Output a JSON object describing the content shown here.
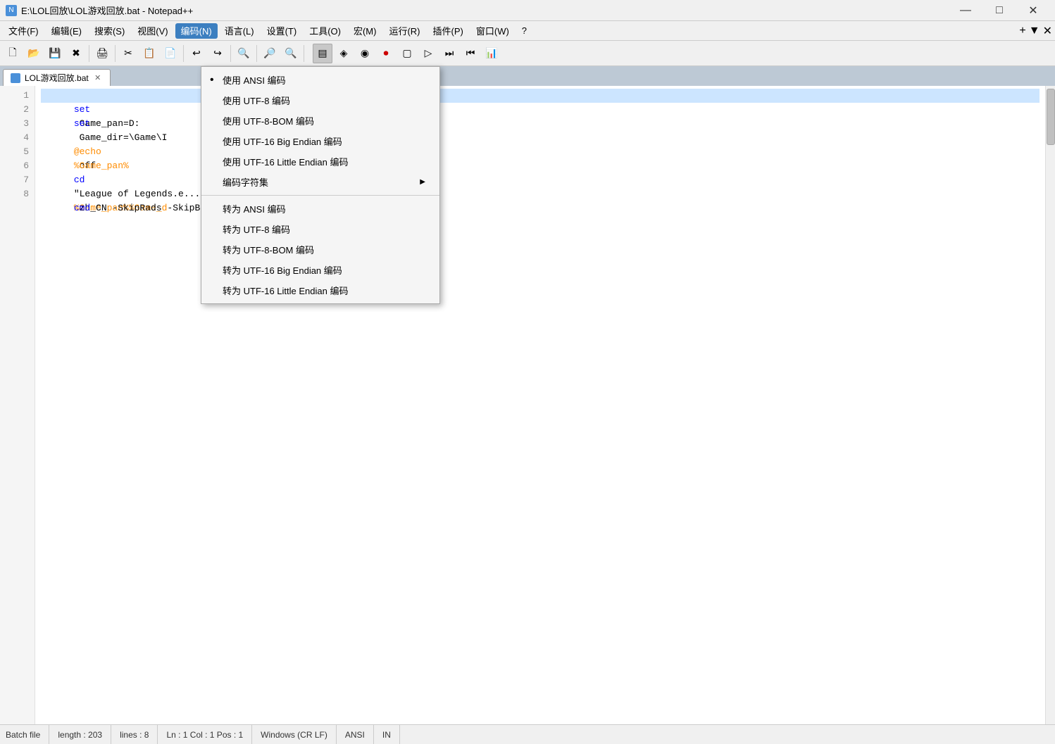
{
  "window": {
    "title": "E:\\LOL回放\\LOL游戏回放.bat - Notepad++",
    "icon": "N"
  },
  "titlebar": {
    "minimize": "—",
    "maximize": "□",
    "close": "✕"
  },
  "menubar": {
    "items": [
      {
        "id": "file",
        "label": "文件(F)"
      },
      {
        "id": "edit",
        "label": "编辑(E)"
      },
      {
        "id": "search",
        "label": "搜索(S)"
      },
      {
        "id": "view",
        "label": "视图(V)"
      },
      {
        "id": "encoding",
        "label": "编码(N)",
        "active": true
      },
      {
        "id": "language",
        "label": "语言(L)"
      },
      {
        "id": "settings",
        "label": "设置(T)"
      },
      {
        "id": "tools",
        "label": "工具(O)"
      },
      {
        "id": "macro",
        "label": "宏(M)"
      },
      {
        "id": "run",
        "label": "运行(R)"
      },
      {
        "id": "plugins",
        "label": "插件(P)"
      },
      {
        "id": "window",
        "label": "窗口(W)"
      },
      {
        "id": "help",
        "label": "?"
      }
    ]
  },
  "toolbar": {
    "buttons": [
      "📄",
      "📂",
      "💾",
      "🖨️",
      "✂️",
      "📋",
      "📃",
      "↩️",
      "↪️",
      "🔍",
      "🔎",
      "="
    ],
    "right_buttons": [
      "▶",
      "⏹",
      "⏺",
      "⏸",
      "⏭",
      "⏮",
      "📊"
    ]
  },
  "tab": {
    "name": "LOL游戏回放.bat",
    "active": true
  },
  "editor": {
    "lines": [
      {
        "num": 1,
        "content": "set Game_pan=D:",
        "type": "set"
      },
      {
        "num": 2,
        "content": "set Game_dir=\\Game\\I",
        "type": "set"
      },
      {
        "num": 3,
        "content": "",
        "type": "empty"
      },
      {
        "num": 4,
        "content": "@echo off",
        "type": "echo"
      },
      {
        "num": 5,
        "content": "%Game_pan%",
        "type": "var"
      },
      {
        "num": 6,
        "content": "cd %Game_pan%%Game_d",
        "type": "cd"
      },
      {
        "num": 7,
        "content": "\"League of Legends.e... zh_CN -SkipRads -SkipBuild",
        "type": "str"
      },
      {
        "num": 8,
        "content": "cmd",
        "type": "cmd"
      }
    ]
  },
  "encoding_menu": {
    "use_items": [
      {
        "label": "使用 ANSI 编码",
        "checked": true
      },
      {
        "label": "使用 UTF-8 编码",
        "checked": false
      },
      {
        "label": "使用 UTF-8-BOM 编码",
        "checked": false
      },
      {
        "label": "使用 UTF-16 Big Endian 编码",
        "checked": false
      },
      {
        "label": "使用 UTF-16 Little Endian 编码",
        "checked": false
      },
      {
        "label": "编码字符集",
        "checked": false,
        "submenu": true
      }
    ],
    "convert_items": [
      {
        "label": "转为 ANSI 编码",
        "checked": false
      },
      {
        "label": "转为 UTF-8 编码",
        "checked": false
      },
      {
        "label": "转为 UTF-8-BOM 编码",
        "checked": false
      },
      {
        "label": "转为 UTF-16 Big Endian 编码",
        "checked": false
      },
      {
        "label": "转为 UTF-16 Little Endian 编码",
        "checked": false
      }
    ]
  },
  "statusbar": {
    "filetype": "Batch file",
    "length": "length : 203",
    "lines": "lines : 8",
    "cursor": "Ln : 1   Col : 1   Pos : 1",
    "lineending": "Windows (CR LF)",
    "encoding": "ANSI",
    "ins": "IN"
  }
}
